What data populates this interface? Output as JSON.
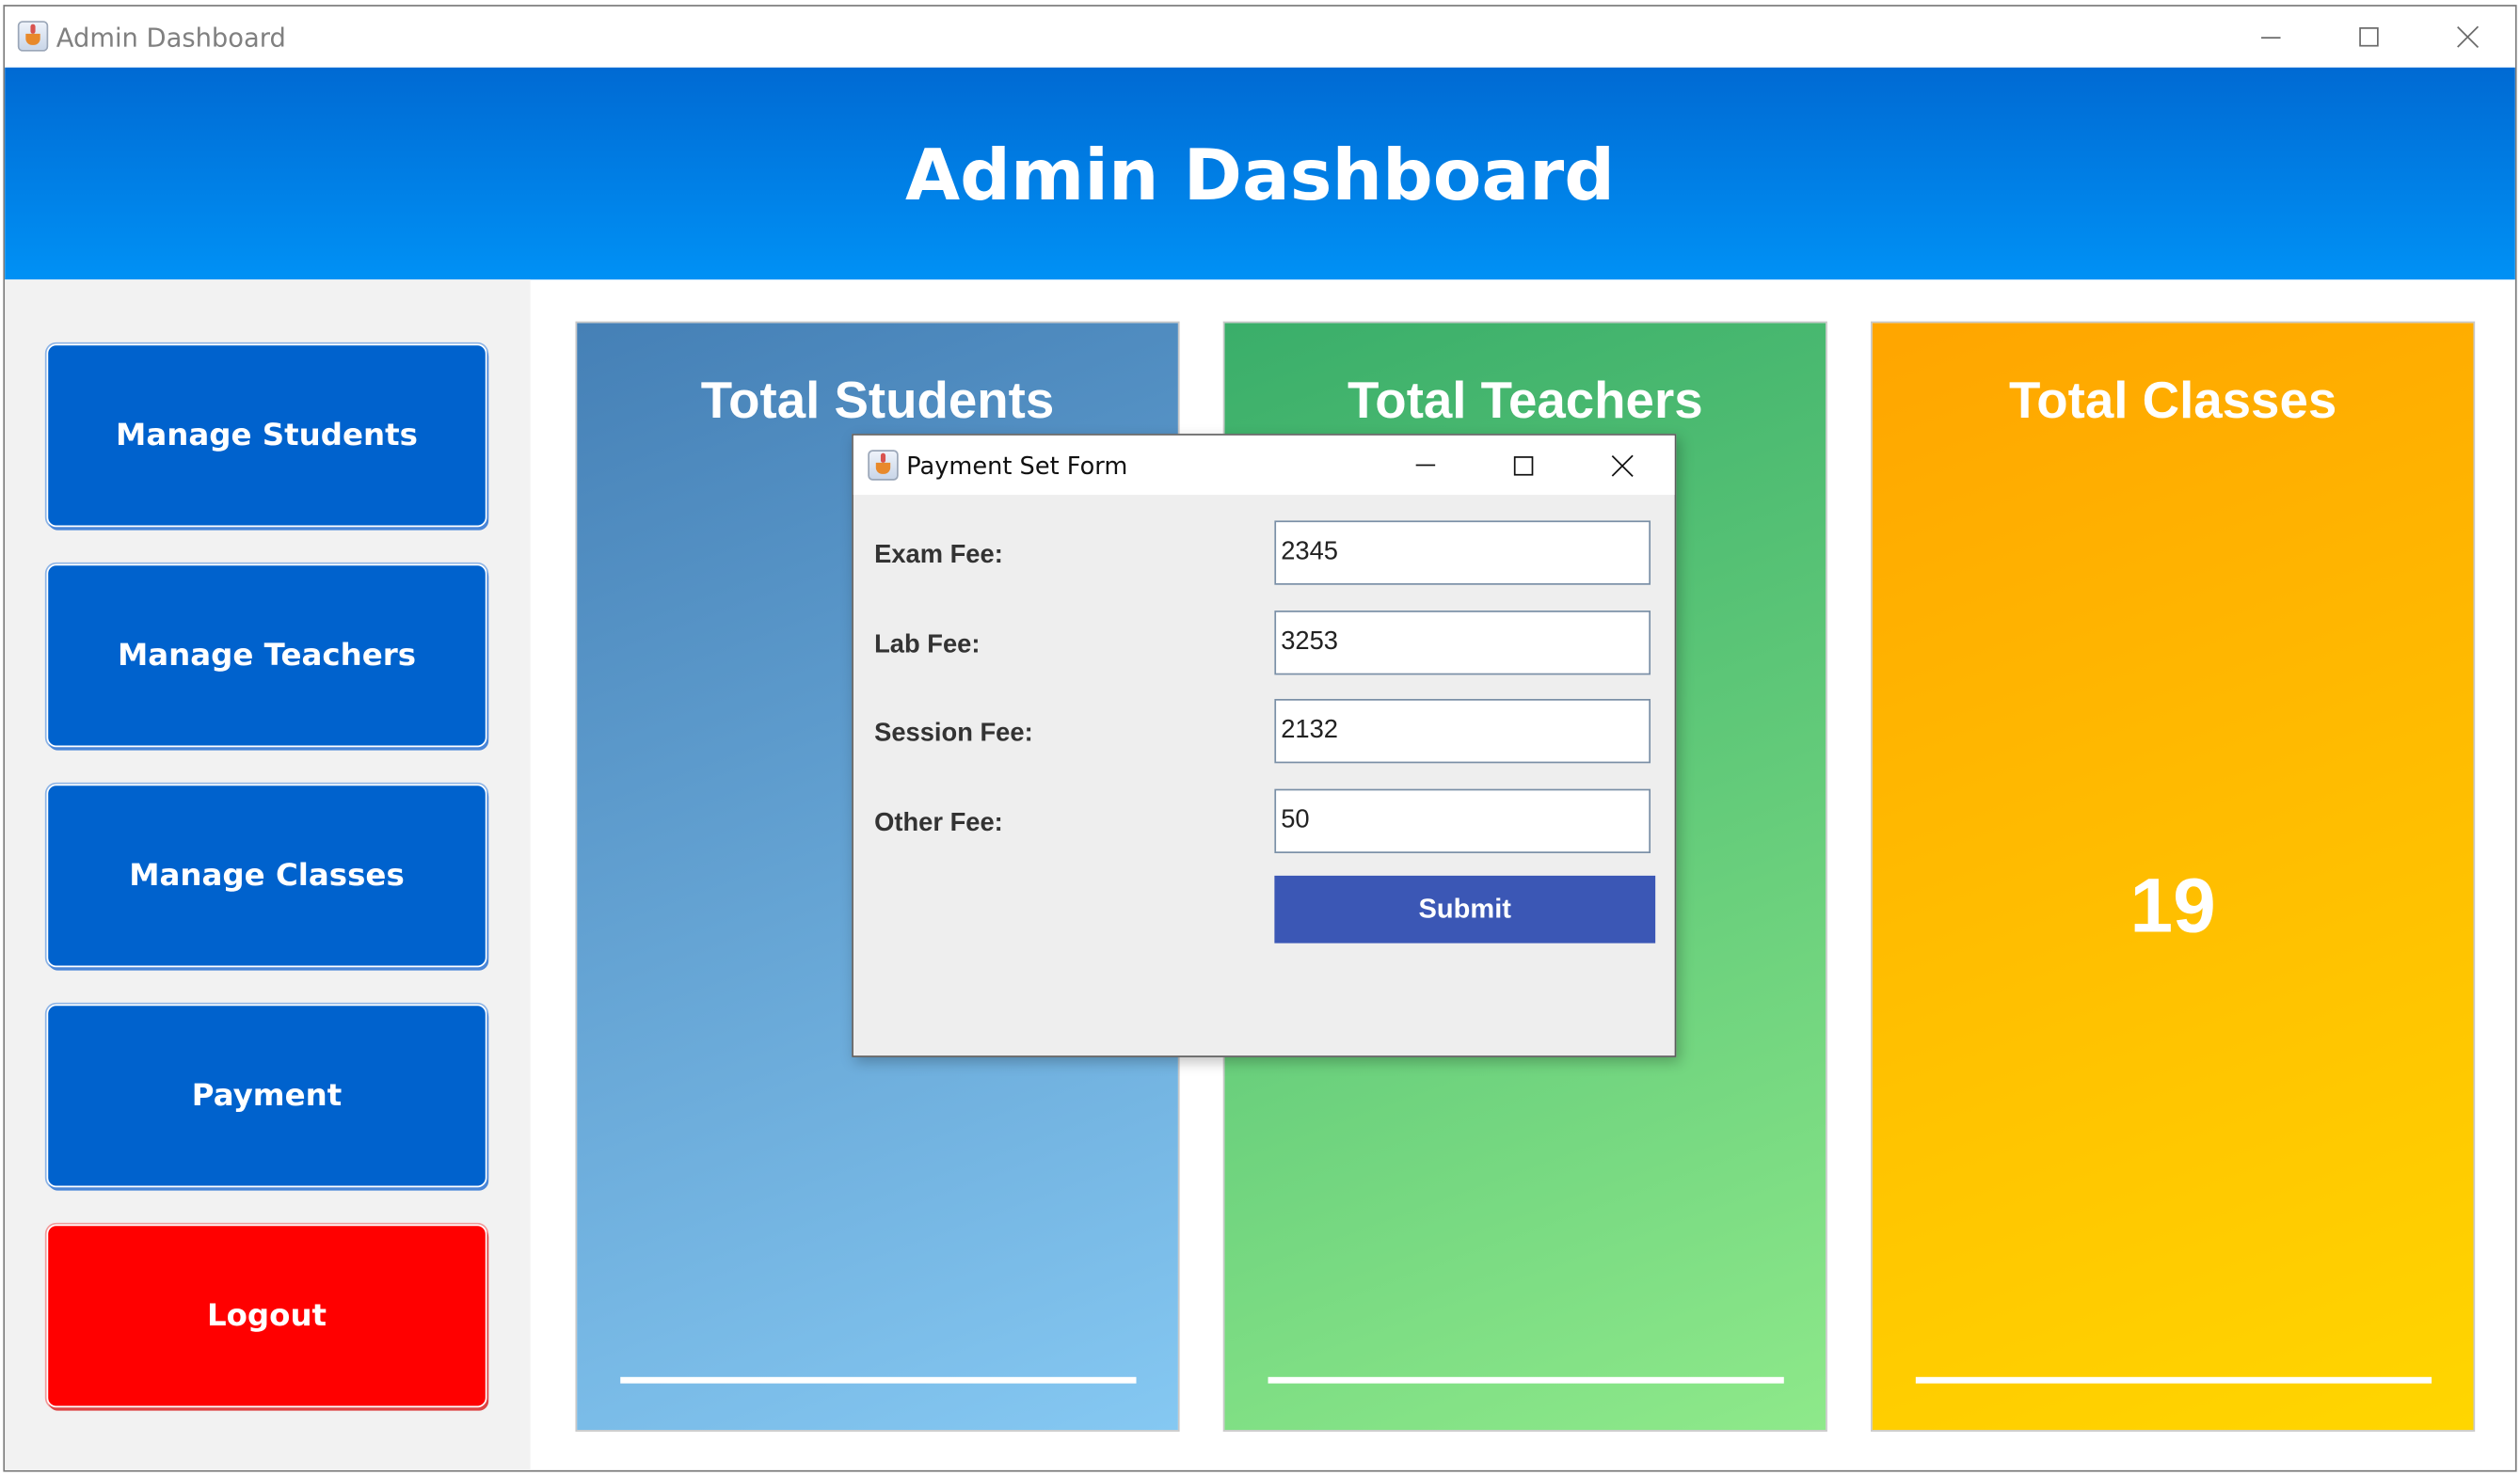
{
  "window": {
    "title": "Admin Dashboard"
  },
  "header": {
    "title": "Admin Dashboard"
  },
  "sidebar": {
    "items": [
      {
        "label": "Manage Students"
      },
      {
        "label": "Manage Teachers"
      },
      {
        "label": "Manage Classes"
      },
      {
        "label": "Payment"
      },
      {
        "label": "Logout"
      }
    ]
  },
  "cards": {
    "students": {
      "title": "Total Students",
      "value": ""
    },
    "teachers": {
      "title": "Total Teachers",
      "value": ""
    },
    "classes": {
      "title": "Total Classes",
      "value": "19"
    }
  },
  "dialog": {
    "title": "Payment Set Form",
    "fields": [
      {
        "label": "Exam Fee:",
        "value": "2345"
      },
      {
        "label": "Lab Fee:",
        "value": "3253"
      },
      {
        "label": "Session Fee:",
        "value": "2132"
      },
      {
        "label": "Other Fee:",
        "value": "50"
      }
    ],
    "submit_label": "Submit"
  },
  "colors": {
    "header_top": "#006ad3",
    "header_bottom": "#0091f5",
    "sidebar_button": "#0062cd",
    "logout_button": "#ff0000",
    "students_card": "#4580b6",
    "teachers_card": "#3aae6a",
    "classes_card": "#ffa500",
    "submit_button": "#3b57b5"
  },
  "icons": {
    "app": "java-icon",
    "minimize": "minimize-icon",
    "maximize": "maximize-icon",
    "close": "close-icon"
  }
}
